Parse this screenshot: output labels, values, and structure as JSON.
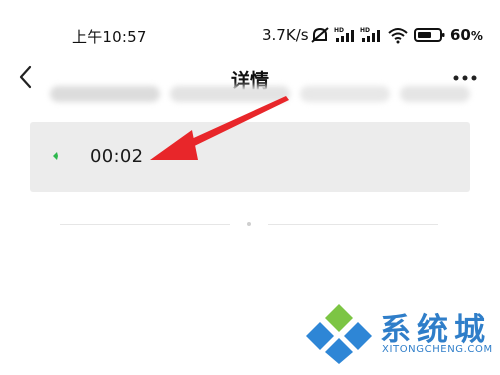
{
  "status_bar": {
    "time": "上午10:57",
    "net_speed": "3.7K/s",
    "battery_value": "60",
    "battery_unit": "%",
    "icons": [
      "mute-alarm-icon",
      "signal-hd-1-icon",
      "signal-hd-2-icon",
      "wifi-icon",
      "battery-icon"
    ]
  },
  "nav": {
    "title": "详情",
    "back_icon": "chevron-left-icon",
    "more_icon": "more-horizontal-icon"
  },
  "message": {
    "duration": "00:02",
    "indicator_color": "#2db84d"
  },
  "annotation": {
    "arrow_color": "#e8262a"
  },
  "watermark": {
    "brand": "系统城",
    "domain": "XITONGCHENG.COM",
    "color": "#2f7ec9"
  }
}
